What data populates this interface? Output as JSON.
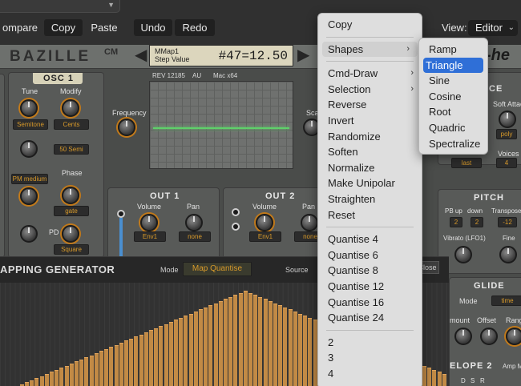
{
  "toolbar": {
    "compare": "ompare",
    "copy": "Copy",
    "paste": "Paste",
    "undo": "Undo",
    "redo": "Redo",
    "view_label": "View:",
    "view_value": "Editor"
  },
  "plugin": {
    "logo": "BAZILLE",
    "logo_cm": "CM",
    "display_line1": "MMap1",
    "display_line2": "Step Value",
    "display_value": "#47=12.50",
    "brand_right": "-he",
    "info": [
      "REV 12185",
      "AU",
      "Mac x64"
    ],
    "osc1": {
      "title": "OSC 1",
      "tune_label": "Tune",
      "modify_label": "Modify",
      "tune_value": "Semitone",
      "modify_value": "Cents",
      "semi_value": "50 Semi",
      "pm_value": "PM medium",
      "phase_label": "Phase",
      "phase_value": "gate",
      "pd_label": "PD",
      "pd_value": "Square"
    },
    "frequency_label": "Frequency",
    "sca_label": "Sca",
    "out1": {
      "title": "OUT 1",
      "volume_label": "Volume",
      "pan_label": "Pan",
      "volume_value": "Env1",
      "pan_value": "none"
    },
    "out2": {
      "title": "OUT 2",
      "volume_label": "Volume",
      "pan_label": "Pan",
      "volume_value": "Env1",
      "pan_value": "none"
    },
    "right": {
      "ce": "CE",
      "soft_attack": "Soft Attac",
      "poly": "poly",
      "voices_label": "Voices",
      "last_value": "last",
      "voices_value": "4",
      "pitch_title": "PITCH",
      "pb_up": "PB up",
      "down": "down",
      "transpose": "Transpose",
      "pb_up_value": "2",
      "down_value": "2",
      "transpose_value": "-12",
      "vibrato": "Vibrato (LFO1)",
      "fine": "Fine",
      "glide_title": "GLIDE",
      "mode_label": "Mode",
      "mode_value": "time",
      "amount": "mount",
      "offset": "Offset",
      "range": "Rang",
      "envelope2": "ELOPE 2",
      "amp_m": "Amp M",
      "dsr": [
        "D",
        "S",
        "R"
      ]
    },
    "mapgen": {
      "title": "APPING GENERATOR",
      "mode_label": "Mode",
      "mode_value": "Map Quantise",
      "source_label": "Source",
      "close_label": "Close",
      "bars": [
        0.02,
        0.04,
        0.06,
        0.08,
        0.1,
        0.12,
        0.14,
        0.16,
        0.18,
        0.2,
        0.22,
        0.24,
        0.26,
        0.28,
        0.3,
        0.32,
        0.34,
        0.36,
        0.38,
        0.4,
        0.42,
        0.44,
        0.46,
        0.48,
        0.5,
        0.52,
        0.54,
        0.56,
        0.58,
        0.6,
        0.62,
        0.64,
        0.66,
        0.68,
        0.7,
        0.72,
        0.74,
        0.76,
        0.78,
        0.8,
        0.82,
        0.84,
        0.86,
        0.88,
        0.9,
        0.92,
        0.94,
        0.96,
        0.98,
        1.0,
        0.98,
        0.96,
        0.94,
        0.92,
        0.9,
        0.88,
        0.86,
        0.84,
        0.82,
        0.8,
        0.78,
        0.76,
        0.74,
        0.72,
        0.7,
        0.68,
        0.66,
        0.64,
        0.62,
        0.6,
        0.58,
        0.56,
        0.54,
        0.52,
        0.5,
        0.48,
        0.46,
        0.44,
        0.42,
        0.4,
        0.38,
        0.36,
        0.34,
        0.32,
        0.3,
        0.28,
        0.26,
        0.24,
        0.22,
        0.2
      ]
    }
  },
  "context_menu": {
    "items": [
      {
        "label": "Copy"
      },
      {
        "sep": true
      },
      {
        "label": "Shapes",
        "submenu": true,
        "highlighted": true
      },
      {
        "sep": true
      },
      {
        "label": "Cmd-Draw",
        "submenu": true
      },
      {
        "label": "Selection",
        "submenu": true
      },
      {
        "label": "Reverse"
      },
      {
        "label": "Invert"
      },
      {
        "label": "Randomize"
      },
      {
        "label": "Soften"
      },
      {
        "label": "Normalize"
      },
      {
        "label": "Make Unipolar"
      },
      {
        "label": "Straighten"
      },
      {
        "label": "Reset"
      },
      {
        "sep": true
      },
      {
        "label": "Quantise 4"
      },
      {
        "label": "Quantise 6"
      },
      {
        "label": "Quantise 8"
      },
      {
        "label": "Quantise 12"
      },
      {
        "label": "Quantise 16"
      },
      {
        "label": "Quantise 24"
      },
      {
        "sep": true
      },
      {
        "label": "2"
      },
      {
        "label": "3"
      },
      {
        "label": "4"
      }
    ]
  },
  "shapes_submenu": {
    "items": [
      {
        "label": "Ramp"
      },
      {
        "label": "Triangle",
        "selected": true
      },
      {
        "label": "Sine"
      },
      {
        "label": "Cosine"
      },
      {
        "label": "Root"
      },
      {
        "label": "Quadric"
      },
      {
        "label": "Spectralize"
      }
    ]
  }
}
